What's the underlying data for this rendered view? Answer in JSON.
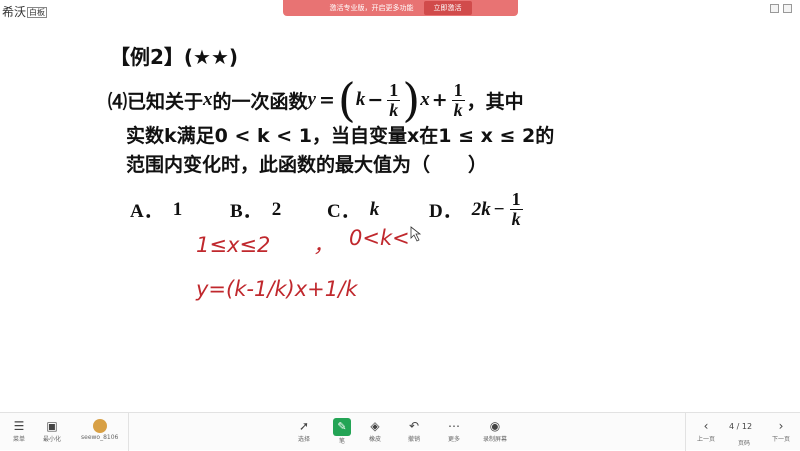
{
  "app": {
    "logo_text": "希沃",
    "logo_badge": "白板"
  },
  "banner": {
    "text": "激活专业版，开启更多功能",
    "button": "立即激活"
  },
  "problem": {
    "title": "【例2】(★★)",
    "num": "⑷",
    "line1_a": "已知关于",
    "var_x": "x",
    "line1_b": "的一次函数",
    "var_y": "y",
    "eq": "=",
    "k": "k",
    "minus": "−",
    "one": "1",
    "plus": "+",
    "line1_end": "，其中",
    "line2": "实数k满足0 < k < 1，当自变量x在1 ≤ x ≤ 2的",
    "line3": "范围内变化时，此函数的最大值为（　　）",
    "options": [
      {
        "letter": "A．",
        "value": "1"
      },
      {
        "letter": "B．",
        "value": "2"
      },
      {
        "letter": "C．",
        "value": "k"
      },
      {
        "letter": "D．",
        "value": "2k"
      }
    ]
  },
  "handwriting": {
    "line1_a": "1≤x≤2",
    "comma": "，",
    "line1_b": "0<k<",
    "line2": "y=(k-1/k)x+1/k"
  },
  "toolbar": {
    "left": [
      {
        "label": "菜单",
        "icon": "menu-icon"
      },
      {
        "label": "最小化",
        "icon": "minimize-icon"
      },
      {
        "label": "seewo_8106",
        "icon": "avatar-icon"
      }
    ],
    "center": [
      {
        "label": "选择",
        "icon": "cursor-icon"
      },
      {
        "label": "笔",
        "icon": "pen-icon"
      },
      {
        "label": "橡皮",
        "icon": "eraser-icon"
      },
      {
        "label": "撤销",
        "icon": "undo-icon"
      },
      {
        "label": "更多",
        "icon": "more-icon"
      },
      {
        "label": "录制屏幕",
        "icon": "record-icon"
      }
    ],
    "right": [
      {
        "label": "上一页",
        "icon": "prev-icon"
      },
      {
        "label": "页码",
        "icon": "page-icon"
      },
      {
        "label": "下一页",
        "icon": "next-icon"
      }
    ],
    "page_indicator": "4 / 12"
  },
  "colors": {
    "ink": "#111111",
    "handwriting": "#c0282d",
    "active_tool": "#23a455",
    "banner": "#e87373"
  }
}
